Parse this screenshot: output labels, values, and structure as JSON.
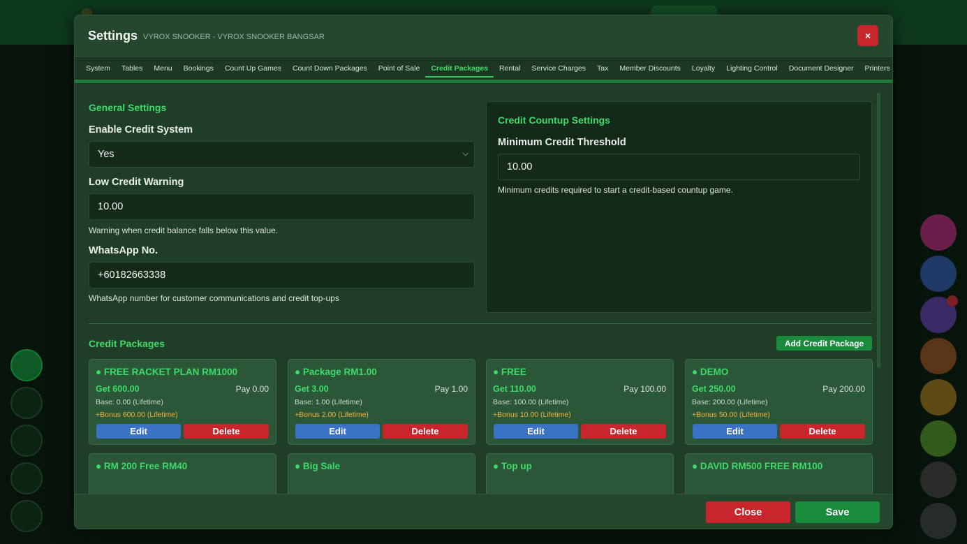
{
  "modal": {
    "title": "Settings",
    "subtitle": "VYROX SNOOKER - VYROX SNOOKER BANGSAR",
    "close_icon": "×"
  },
  "tabs": [
    {
      "label": "System"
    },
    {
      "label": "Tables"
    },
    {
      "label": "Menu"
    },
    {
      "label": "Bookings"
    },
    {
      "label": "Count Up Games"
    },
    {
      "label": "Count Down Packages"
    },
    {
      "label": "Point of Sale"
    },
    {
      "label": "Credit Packages",
      "active": true
    },
    {
      "label": "Rental"
    },
    {
      "label": "Service Charges"
    },
    {
      "label": "Tax"
    },
    {
      "label": "Member Discounts"
    },
    {
      "label": "Loyalty"
    },
    {
      "label": "Lighting Control"
    },
    {
      "label": "Document Designer"
    },
    {
      "label": "Printers"
    }
  ],
  "general": {
    "title": "General Settings",
    "enable_label": "Enable Credit System",
    "enable_value": "Yes",
    "low_label": "Low Credit Warning",
    "low_value": "10.00",
    "low_help": "Warning when credit balance falls below this value.",
    "whatsapp_label": "WhatsApp No.",
    "whatsapp_value": "+60182663338",
    "whatsapp_help": "WhatsApp number for customer communications and credit top-ups"
  },
  "countup": {
    "title": "Credit Countup Settings",
    "min_label": "Minimum Credit Threshold",
    "min_value": "10.00",
    "min_help": "Minimum credits required to start a credit-based countup game."
  },
  "packages": {
    "title": "Credit Packages",
    "add_label": "Add Credit Package",
    "edit_label": "Edit",
    "delete_label": "Delete",
    "items": [
      {
        "name": "FREE RACKET PLAN RM1000",
        "get": "Get 600.00",
        "pay": "Pay 0.00",
        "base": "Base: 0.00 (Lifetime)",
        "bonus": "+Bonus 600.00 (Lifetime)"
      },
      {
        "name": "Package RM1.00",
        "get": "Get 3.00",
        "pay": "Pay 1.00",
        "base": "Base: 1.00 (Lifetime)",
        "bonus": "+Bonus 2.00 (Lifetime)"
      },
      {
        "name": "FREE",
        "get": "Get 110.00",
        "pay": "Pay 100.00",
        "base": "Base: 100.00 (Lifetime)",
        "bonus": "+Bonus 10.00 (Lifetime)"
      },
      {
        "name": "DEMO",
        "get": "Get 250.00",
        "pay": "Pay 200.00",
        "base": "Base: 200.00 (Lifetime)",
        "bonus": "+Bonus 50.00 (Lifetime)"
      },
      {
        "name": "RM 200 Free RM40"
      },
      {
        "name": "Big Sale"
      },
      {
        "name": "Top up"
      },
      {
        "name": "DAVID RM500 FREE RM100"
      }
    ]
  },
  "footer": {
    "close_label": "Close",
    "save_label": "Save"
  },
  "colors": {
    "accent": "#3ddc6a",
    "edit": "#3a72c5",
    "delete": "#c9252c",
    "save": "#1a8a3d",
    "bonus": "#f4b43a"
  }
}
